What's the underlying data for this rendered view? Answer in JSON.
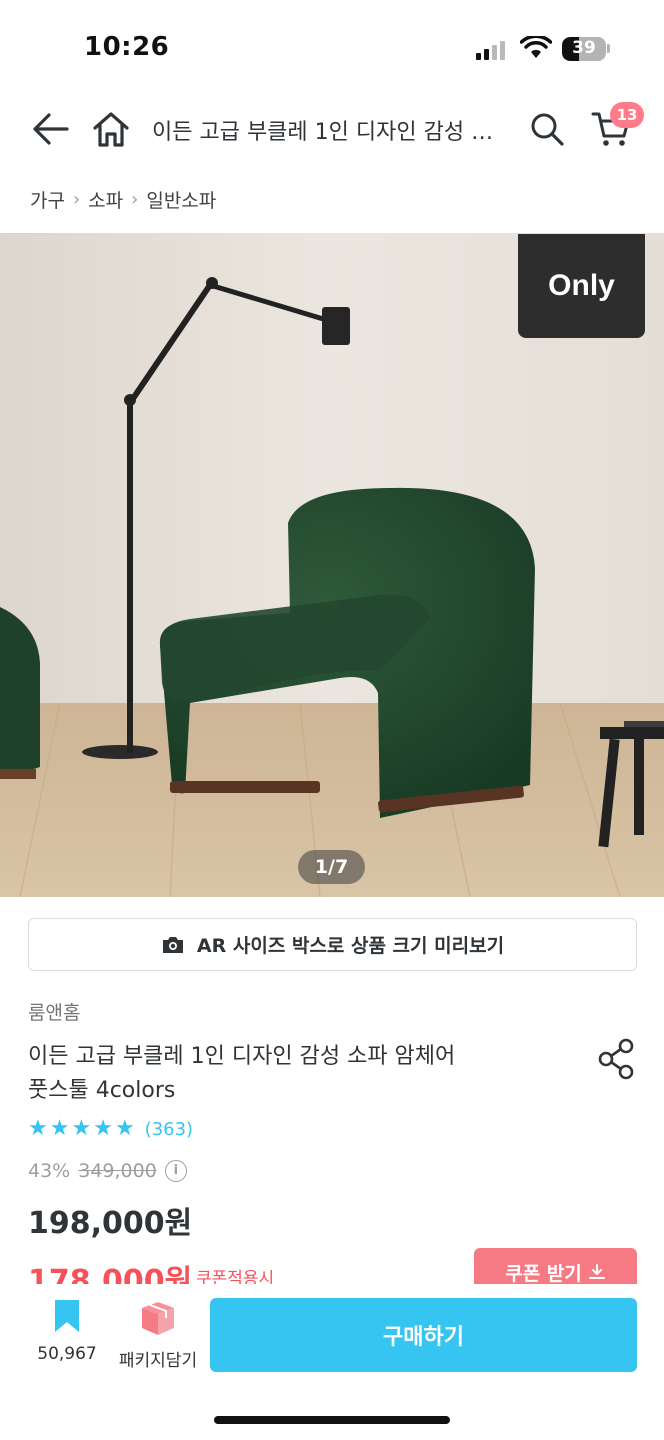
{
  "status_bar": {
    "time": "10:26",
    "battery": "39",
    "battery_level": 0.39
  },
  "header": {
    "title": "이든 고급 부클레 1인 디자인 감성 소파 암체어 풋스툴 4colors",
    "cart_count": "13"
  },
  "breadcrumb": [
    "가구",
    "소파",
    "일반소파"
  ],
  "hero": {
    "badge": "Only",
    "page_indicator": "1/7"
  },
  "ar_button": {
    "label": "AR 사이즈 박스로 상품 크기 미리보기"
  },
  "product": {
    "brand": "룸앤홈",
    "name_line1": "이든 고급 부클레 1인 디자인 감성 소파 암체어",
    "name_line2": "풋스툴 4colors",
    "rating_stars": 5,
    "review_count": "(363)",
    "discount": "43%",
    "original_price": "349,000",
    "price": "198,000원",
    "coupon_price": "178,000원",
    "coupon_note": "쿠폰적용시",
    "coupon_button": "쿠폰 받기"
  },
  "bottom_bar": {
    "bookmark_count": "50,967",
    "package_label": "패키지담기",
    "buy_label": "구매하기"
  },
  "colors": {
    "accent": "#35c5f0",
    "coupon": "#f7525a",
    "badge": "#ff7b8a",
    "text": "#2f3438"
  }
}
